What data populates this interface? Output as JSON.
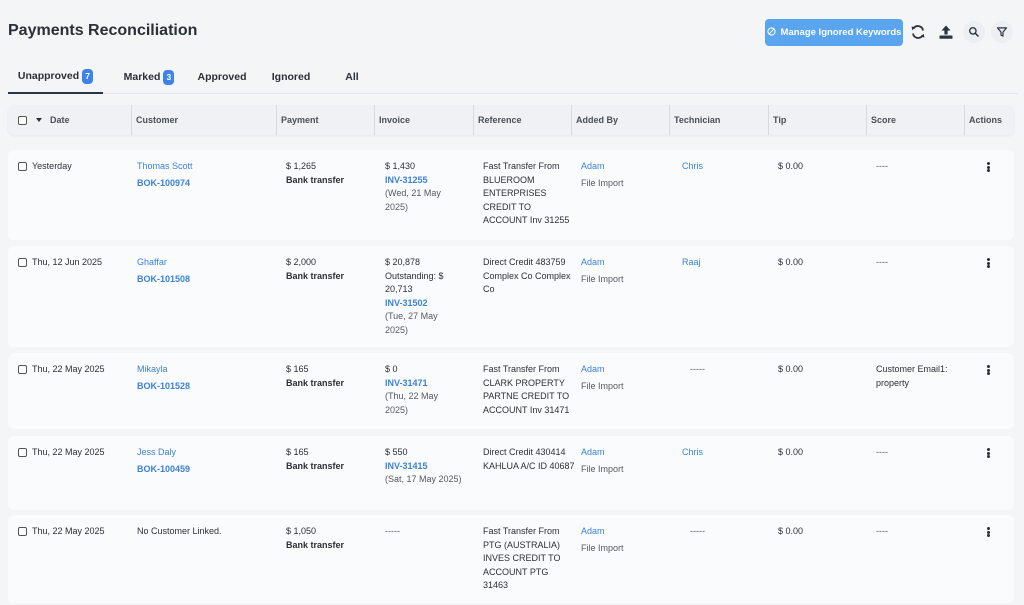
{
  "page": {
    "title": "Payments Reconciliation"
  },
  "toolbar": {
    "manage_button_label": "Manage Ignored Keywords",
    "icons": [
      "ban-icon",
      "refresh-icon",
      "upload-icon",
      "search-icon",
      "filter-icon"
    ]
  },
  "tabs": [
    {
      "label": "Unapproved",
      "badge": "7",
      "active": true
    },
    {
      "label": "Marked",
      "badge": "3",
      "active": false
    },
    {
      "label": "Approved",
      "badge": "",
      "active": false
    },
    {
      "label": "Ignored",
      "badge": "",
      "active": false
    },
    {
      "label": "All",
      "badge": "",
      "active": false
    }
  ],
  "columns": [
    "Date",
    "Customer",
    "Payment",
    "Invoice",
    "Reference",
    "Added By",
    "Technician",
    "Tip",
    "Score",
    "Actions"
  ],
  "rows": [
    {
      "date": "Yesterday",
      "customer_name": "Thomas Scott",
      "customer_id": "BOK-100974",
      "payment_amount": "$ 1,265",
      "payment_method": "Bank transfer",
      "invoice_amount": "$ 1,430",
      "invoice_outstanding": "",
      "invoice_id": "INV-31255",
      "invoice_date": "(Wed, 21 May 2025)",
      "reference": "Fast Transfer From BLUEROOM ENTERPRISES CREDIT TO ACCOUNT Inv 31255",
      "added_by": "Adam",
      "source": "File Import",
      "technician": "Chris",
      "tip": "$ 0.00",
      "score": "----"
    },
    {
      "date": "Thu, 12 Jun 2025",
      "customer_name": "Ghaffar",
      "customer_id": "BOK-101508",
      "payment_amount": "$ 2,000",
      "payment_method": "Bank transfer",
      "invoice_amount": "$ 20,878",
      "invoice_outstanding": "Outstanding: $ 20,713",
      "invoice_id": "INV-31502",
      "invoice_date": "(Tue, 27 May 2025)",
      "reference": "Direct Credit 483759 Complex Co Complex Co",
      "added_by": "Adam",
      "source": "File Import",
      "technician": "Raaj",
      "tip": "$ 0.00",
      "score": "----"
    },
    {
      "date": "Thu, 22 May 2025",
      "customer_name": "Mikayla",
      "customer_id": "BOK-101528",
      "payment_amount": "$ 165",
      "payment_method": "Bank transfer",
      "invoice_amount": "$ 0",
      "invoice_outstanding": "",
      "invoice_id": "INV-31471",
      "invoice_date": "(Thu, 22 May 2025)",
      "reference": "Fast Transfer From CLARK PROPERTY PARTNE CREDIT TO ACCOUNT Inv 31471",
      "added_by": "Adam",
      "source": "File Import",
      "technician": "-----",
      "tip": "$ 0.00",
      "score": "Customer Email1: property"
    },
    {
      "date": "Thu, 22 May 2025",
      "customer_name": "Jess Daly",
      "customer_id": "BOK-100459",
      "payment_amount": "$ 165",
      "payment_method": "Bank transfer",
      "invoice_amount": "$ 550",
      "invoice_outstanding": "",
      "invoice_id": "INV-31415",
      "invoice_date": "(Sat, 17 May 2025)",
      "reference": "Direct Credit 430414 KAHLUA A/C ID 40687",
      "added_by": "Adam",
      "source": "File Import",
      "technician": "Chris",
      "tip": "$ 0.00",
      "score": "----"
    },
    {
      "date": "Thu, 22 May 2025",
      "customer_name": "No Customer Linked.",
      "customer_id": "",
      "payment_amount": "$ 1,050",
      "payment_method": "Bank transfer",
      "invoice_amount": "-----",
      "invoice_outstanding": "",
      "invoice_id": "",
      "invoice_date": "",
      "reference": "Fast Transfer From PTG (AUSTRALIA) INVES CREDIT TO ACCOUNT PTG 31463",
      "added_by": "Adam",
      "source": "File Import",
      "technician": "-----",
      "tip": "$ 0.00",
      "score": "----"
    }
  ]
}
